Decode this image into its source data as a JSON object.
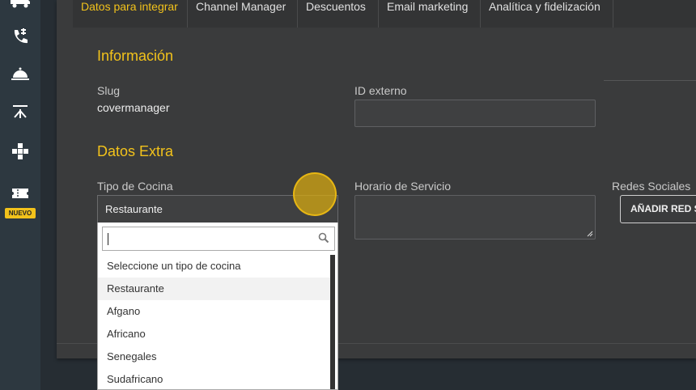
{
  "sidebar": {
    "items": [
      {
        "icon": "truck-icon"
      },
      {
        "icon": "phone-transfer-icon"
      },
      {
        "icon": "cloche-icon"
      },
      {
        "icon": "table-icon"
      },
      {
        "icon": "gamepad-icon"
      },
      {
        "icon": "ticket-icon",
        "badge": "NUEVO"
      }
    ]
  },
  "tabs": [
    {
      "label": "Datos para integrar",
      "active": true
    },
    {
      "label": "Channel Manager",
      "active": false
    },
    {
      "label": "Descuentos",
      "active": false
    },
    {
      "label": "Email marketing",
      "active": false
    },
    {
      "label": "Analítica y fidelización",
      "active": false
    }
  ],
  "info": {
    "title": "Información",
    "slug_label": "Slug",
    "slug_value": "covermanager",
    "external_id_label": "ID externo",
    "external_id_value": ""
  },
  "extra": {
    "title": "Datos Extra",
    "cuisine_label": "Tipo de Cocina",
    "cuisine_value": "Restaurante",
    "schedule_label": "Horario de Servicio",
    "schedule_value": "",
    "social_label": "Redes Sociales",
    "social_button": "AÑADIR RED SOCIAL"
  },
  "dropdown": {
    "search_value": "",
    "options": [
      "Seleccione un tipo de cocina",
      "Restaurante",
      "Afgano",
      "Africano",
      "Senegales",
      "Sudafricano"
    ],
    "selected_index": 1
  },
  "colors": {
    "accent": "#f2c21b",
    "sidebar": "#2d3840",
    "card": "#3a3b3c"
  }
}
